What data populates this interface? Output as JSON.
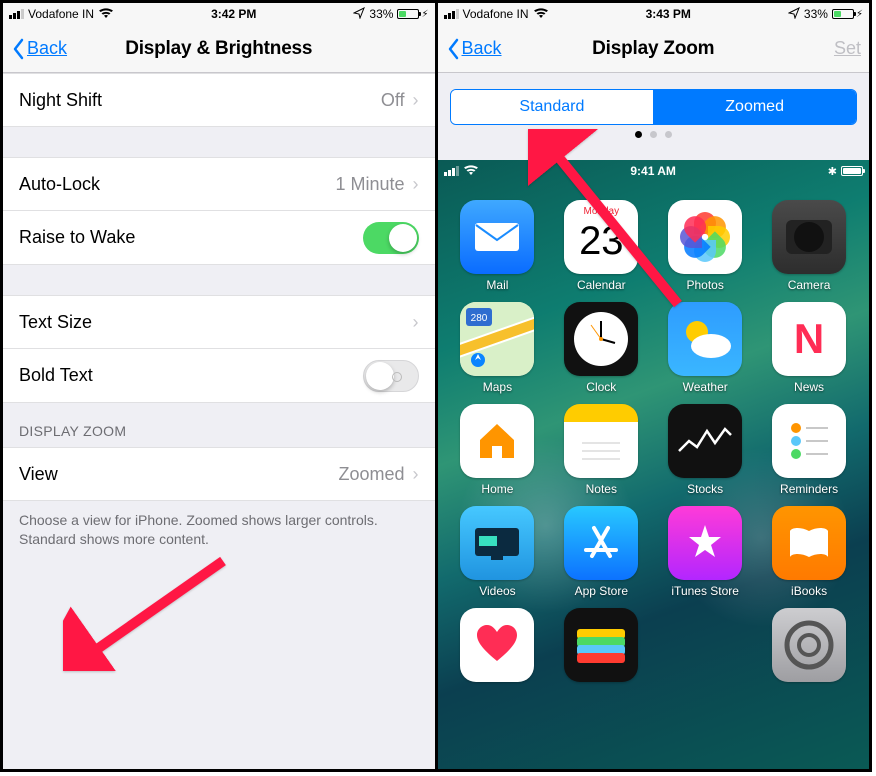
{
  "left": {
    "status": {
      "carrier": "Vodafone IN",
      "time": "3:42 PM",
      "battery": "33%"
    },
    "nav": {
      "back": "Back",
      "title": "Display & Brightness"
    },
    "rows": {
      "nightshift": {
        "label": "Night Shift",
        "value": "Off"
      },
      "autolock": {
        "label": "Auto-Lock",
        "value": "1 Minute"
      },
      "raise": {
        "label": "Raise to Wake"
      },
      "textsize": {
        "label": "Text Size"
      },
      "boldtext": {
        "label": "Bold Text"
      }
    },
    "section": {
      "header": "DISPLAY ZOOM",
      "view": {
        "label": "View",
        "value": "Zoomed"
      },
      "footer": "Choose a view for iPhone. Zoomed shows larger controls. Standard shows more content."
    }
  },
  "right": {
    "status": {
      "carrier": "Vodafone IN",
      "time": "3:43 PM",
      "battery": "33%"
    },
    "nav": {
      "back": "Back",
      "title": "Display Zoom",
      "set": "Set"
    },
    "segment": {
      "standard": "Standard",
      "zoomed": "Zoomed"
    },
    "preview": {
      "status_time": "9:41 AM",
      "cal_day": "Monday",
      "cal_num": "23",
      "apps": [
        "Mail",
        "Calendar",
        "Photos",
        "Camera",
        "Maps",
        "Clock",
        "Weather",
        "News",
        "Home",
        "Notes",
        "Stocks",
        "Reminders",
        "Videos",
        "App Store",
        "iTunes Store",
        "iBooks"
      ]
    }
  }
}
